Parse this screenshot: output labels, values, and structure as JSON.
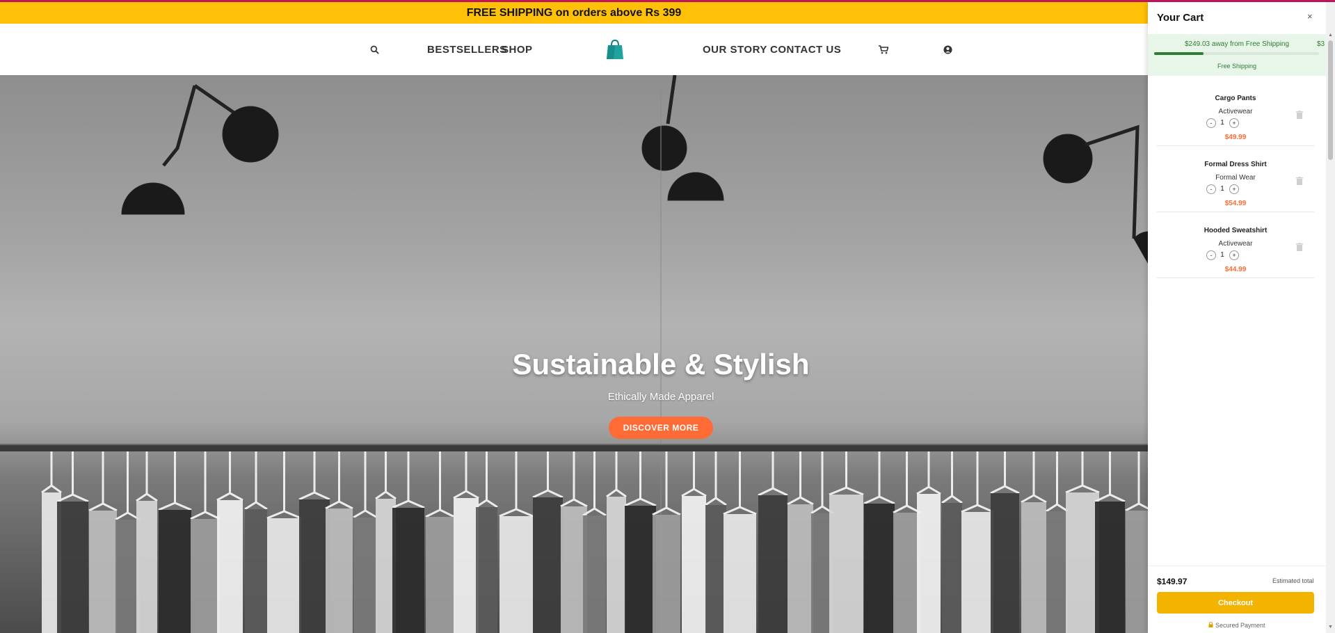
{
  "announcement": "FREE SHIPPING on orders above Rs 399",
  "nav": {
    "bestsellers": "BESTSELLERS",
    "shop": "SHOP",
    "our_story": "OUR STORY",
    "contact_us": "CONTACT US"
  },
  "icons": {
    "search": "search-icon",
    "logo": "shopping-bag-logo-icon",
    "cart": "cart-icon",
    "account": "user-circle-icon",
    "trash": "trash-icon",
    "lock": "lock-icon"
  },
  "hero": {
    "title": "Sustainable & Stylish",
    "subtitle": "Ethically Made Apparel",
    "cta": "DISCOVER MORE"
  },
  "cart": {
    "title": "Your Cart",
    "close": "×",
    "shipping_message": "$249.03 away from Free Shipping",
    "shipping_peek": "$3",
    "shipping_progress_percent": 30,
    "shipping_label": "Free Shipping",
    "items": [
      {
        "name": "Cargo Pants",
        "category": "Activewear",
        "qty": "1",
        "price": "$49.99",
        "minus": "-",
        "plus": "+"
      },
      {
        "name": "Formal Dress Shirt",
        "category": "Formal Wear",
        "qty": "1",
        "price": "$54.99",
        "minus": "-",
        "plus": "+"
      },
      {
        "name": "Hooded Sweatshirt",
        "category": "Activewear",
        "qty": "1",
        "price": "$44.99",
        "minus": "-",
        "plus": "+"
      }
    ],
    "total": "$149.97",
    "total_label": "Estimated total",
    "checkout": "Checkout",
    "secure": "Secured Payment"
  },
  "colors": {
    "announcement_bg": "#ffc107",
    "accent": "#ff6b35",
    "checkout_bg": "#f2b400",
    "shipping_green": "#2e7d32",
    "logo_teal": "#1fa3a0"
  }
}
